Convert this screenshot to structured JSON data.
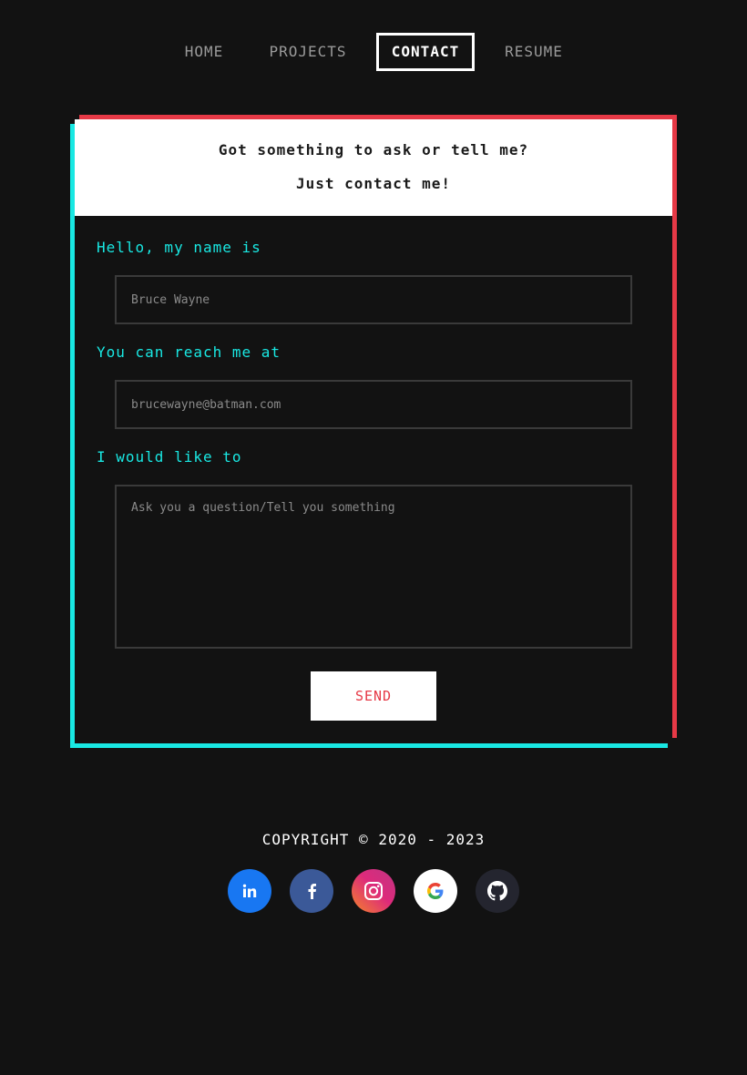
{
  "nav": {
    "items": [
      {
        "label": "HOME",
        "active": false
      },
      {
        "label": "PROJECTS",
        "active": false
      },
      {
        "label": "CONTACT",
        "active": true
      },
      {
        "label": "RESUME",
        "active": false
      }
    ]
  },
  "contact": {
    "heading_line1": "Got something to ask or tell me?",
    "heading_line2": "Just contact me!",
    "name": {
      "label": "Hello, my name is",
      "placeholder": "Bruce Wayne",
      "value": ""
    },
    "email": {
      "label": "You can reach me at",
      "placeholder": "brucewayne@batman.com",
      "value": ""
    },
    "message": {
      "label": "I would like to",
      "placeholder": "Ask you a question/Tell you something",
      "value": ""
    },
    "send_label": "SEND"
  },
  "footer": {
    "copyright": "COPYRIGHT © 2020 - 2023",
    "social": [
      {
        "icon": "linkedin-icon",
        "color": "#1877f2"
      },
      {
        "icon": "facebook-icon",
        "color": "#3b5998"
      },
      {
        "icon": "instagram-icon",
        "color": "#e1306c"
      },
      {
        "icon": "google-icon",
        "color": "#ffffff"
      },
      {
        "icon": "github-icon",
        "color": "#24252f"
      }
    ]
  },
  "colors": {
    "background": "#121212",
    "accent_cyan": "#19e8e3",
    "accent_red": "#e63946"
  }
}
